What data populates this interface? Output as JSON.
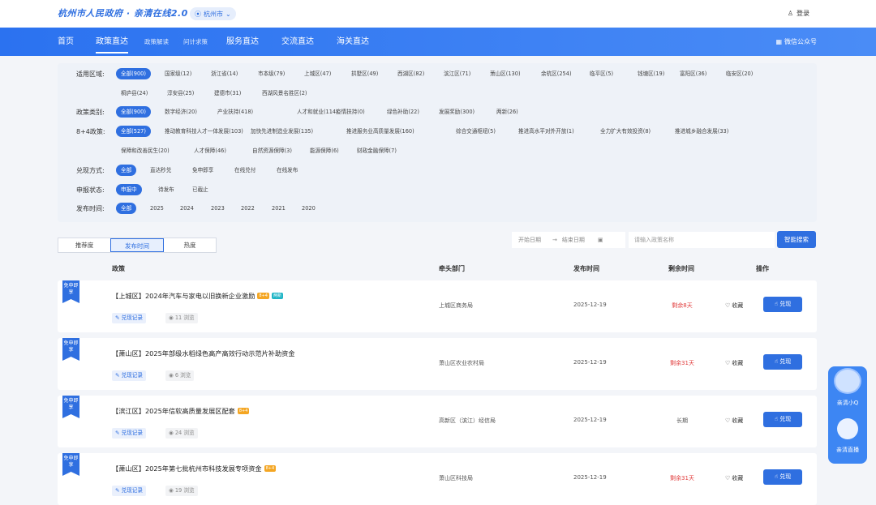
{
  "header": {
    "logo": "杭州市人民政府 · 亲清在线2.0",
    "city": "杭州市",
    "login": "登录"
  },
  "nav": {
    "items": [
      "首页",
      "政策直达",
      "政策解读",
      "问计求策",
      "服务直达",
      "交流直达",
      "海关直达"
    ],
    "wechat": "微信公众号"
  },
  "filters": {
    "region": {
      "label": "适用区域:",
      "chips": [
        "全部(900)",
        "国家级(12)",
        "浙江省(14)",
        "市本级(79)",
        "上城区(47)",
        "拱墅区(49)",
        "西湖区(82)",
        "滨江区(71)",
        "萧山区(130)",
        "余杭区(254)",
        "临平区(5)",
        "钱塘区(19)",
        "富阳区(36)",
        "临安区(20)"
      ],
      "chips2": [
        "桐庐县(24)",
        "淳安县(25)",
        "建德市(31)",
        "西湖风景名胜区(2)"
      ]
    },
    "category": {
      "label": "政策类别:",
      "chips": [
        "全部(900)",
        "数字经济(20)",
        "产业扶持(418)",
        "人才和就业(114)",
        "疫情扶持(0)",
        "绿色补助(22)",
        "发展奖励(300)",
        "两新(26)"
      ]
    },
    "policy84": {
      "label": "8+4政策:",
      "chips": [
        "全部(527)",
        "推动教育科技人才一体发展(103)",
        "加快先进制造业发展(135)",
        "推进服务业高质量发展(160)",
        "综合交通枢纽(5)",
        "推进高水平对外开放(1)",
        "全力扩大有效投资(8)",
        "推进城乡融合发展(33)"
      ],
      "chips2": [
        "保障和改善民生(20)",
        "人才保障(46)",
        "自然资源保障(3)",
        "能源保障(6)",
        "财政金融保障(7)"
      ]
    },
    "method": {
      "label": "兑现方式:",
      "chips": [
        "全部",
        "直达秒兑",
        "免申即享",
        "在线兑付",
        "在线发布"
      ]
    },
    "status": {
      "label": "申报状态:",
      "chips": [
        "申报中",
        "待发布",
        "已截止"
      ]
    },
    "year": {
      "label": "发布时间:",
      "chips": [
        "全部",
        "2025",
        "2024",
        "2023",
        "2022",
        "2021",
        "2020"
      ]
    }
  },
  "sort_tabs": [
    "推荐度",
    "发布时间",
    "热度"
  ],
  "date_range": {
    "start": "开始日期",
    "arrow": "→",
    "end": "结束日期"
  },
  "search": {
    "placeholder": "请输入政策名称",
    "button": "智能搜索"
  },
  "table": {
    "headers": [
      "政策",
      "牵头部门",
      "发布时间",
      "剩余时间",
      "操作"
    ],
    "rows": [
      {
        "ribbon": "免申即享",
        "title": "【上城区】2024年汽车与家电以旧换新企业激励",
        "tags": [
          "8+4",
          "两新"
        ],
        "record": "兑现记录",
        "views": "11 浏览",
        "dept": "上城区商务局",
        "date": "2025-12-19",
        "remain": "剩余8天",
        "fav": "收藏",
        "apply": "兑现"
      },
      {
        "ribbon": "免申即享",
        "title": "【萧山区】2025年部级水稻绿色高产高效行动示范片补助资金",
        "tags": [],
        "record": "兑现记录",
        "views": "6 浏览",
        "dept": "萧山区农业农村局",
        "date": "2025-12-19",
        "remain": "剩余31天",
        "fav": "收藏",
        "apply": "兑现"
      },
      {
        "ribbon": "免申即享",
        "title": "【滨江区】2025年信软高质量发展区配套",
        "tags": [
          "8+4"
        ],
        "record": "兑现记录",
        "views": "24 浏览",
        "dept": "高新区（滨江）经信局",
        "date": "2025-12-19",
        "remain": "长期",
        "fav": "收藏",
        "apply": "兑现"
      },
      {
        "ribbon": "免申即享",
        "title": "【萧山区】2025年第七批杭州市科技发展专项资金",
        "tags": [
          "8+4"
        ],
        "record": "兑现记录",
        "views": "19 浏览",
        "dept": "萧山区科技局",
        "date": "2025-12-19",
        "remain": "剩余31天",
        "fav": "收藏",
        "apply": "兑现"
      }
    ]
  },
  "side": {
    "top": "亲清小Q",
    "bottom": "亲清直播"
  },
  "colors": {
    "brand": "#2f6fe0",
    "danger": "#e03b3b",
    "tag_orange": "#f4a623",
    "tag_teal": "#1fb5c6"
  }
}
